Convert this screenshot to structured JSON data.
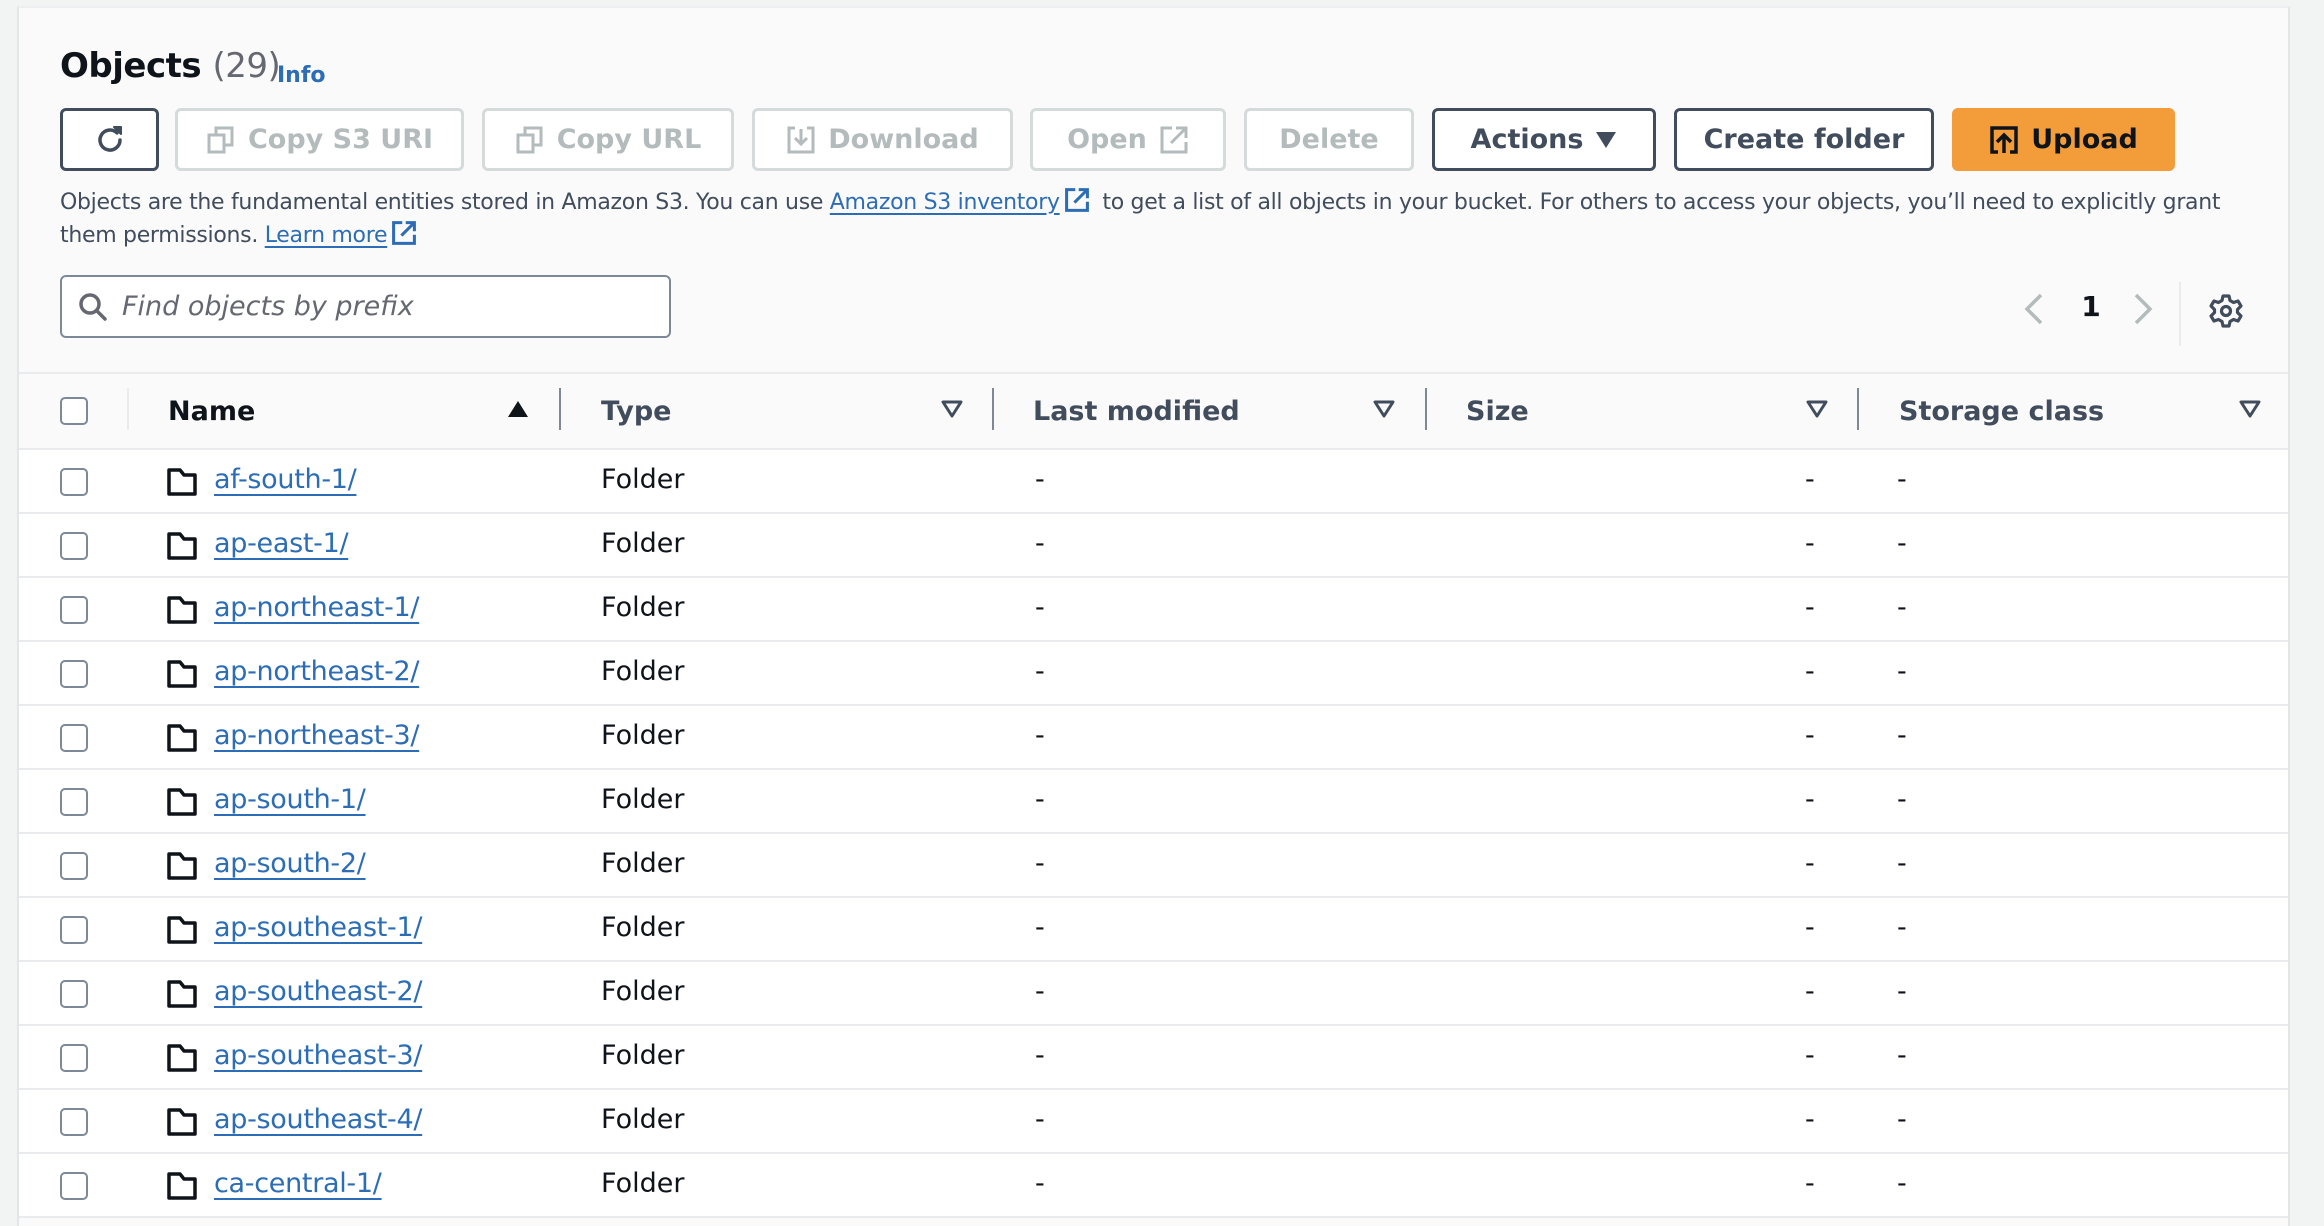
{
  "header": {
    "title": "Objects",
    "count": "(29)",
    "info_label": "Info"
  },
  "toolbar": {
    "refresh_label": "Refresh",
    "copy_s3_uri_label": "Copy S3 URI",
    "copy_url_label": "Copy URL",
    "download_label": "Download",
    "open_label": "Open",
    "delete_label": "Delete",
    "actions_label": "Actions",
    "create_folder_label": "Create folder",
    "upload_label": "Upload"
  },
  "description": {
    "part1": "Objects are the fundamental entities stored in Amazon S3. You can use ",
    "inventory_link": "Amazon S3 inventory",
    "part2": " to get a list of all objects in your bucket. For others to access your objects, you’ll need to explicitly grant them permissions. ",
    "learn_more_link": "Learn more"
  },
  "search": {
    "placeholder": "Find objects by prefix",
    "value": ""
  },
  "pagination": {
    "current_page": "1"
  },
  "table": {
    "columns": [
      {
        "label": "Name",
        "sort": "ascending"
      },
      {
        "label": "Type",
        "sort": "none"
      },
      {
        "label": "Last modified",
        "sort": "none"
      },
      {
        "label": "Size",
        "sort": "none"
      },
      {
        "label": "Storage class",
        "sort": "none"
      }
    ],
    "rows": [
      {
        "name": "af-south-1/",
        "type": "Folder",
        "last_modified": "-",
        "size": "-",
        "storage_class": "-"
      },
      {
        "name": "ap-east-1/",
        "type": "Folder",
        "last_modified": "-",
        "size": "-",
        "storage_class": "-"
      },
      {
        "name": "ap-northeast-1/",
        "type": "Folder",
        "last_modified": "-",
        "size": "-",
        "storage_class": "-"
      },
      {
        "name": "ap-northeast-2/",
        "type": "Folder",
        "last_modified": "-",
        "size": "-",
        "storage_class": "-"
      },
      {
        "name": "ap-northeast-3/",
        "type": "Folder",
        "last_modified": "-",
        "size": "-",
        "storage_class": "-"
      },
      {
        "name": "ap-south-1/",
        "type": "Folder",
        "last_modified": "-",
        "size": "-",
        "storage_class": "-"
      },
      {
        "name": "ap-south-2/",
        "type": "Folder",
        "last_modified": "-",
        "size": "-",
        "storage_class": "-"
      },
      {
        "name": "ap-southeast-1/",
        "type": "Folder",
        "last_modified": "-",
        "size": "-",
        "storage_class": "-"
      },
      {
        "name": "ap-southeast-2/",
        "type": "Folder",
        "last_modified": "-",
        "size": "-",
        "storage_class": "-"
      },
      {
        "name": "ap-southeast-3/",
        "type": "Folder",
        "last_modified": "-",
        "size": "-",
        "storage_class": "-"
      },
      {
        "name": "ap-southeast-4/",
        "type": "Folder",
        "last_modified": "-",
        "size": "-",
        "storage_class": "-"
      },
      {
        "name": "ca-central-1/",
        "type": "Folder",
        "last_modified": "-",
        "size": "-",
        "storage_class": "-"
      }
    ]
  },
  "colors": {
    "primary_button": "#f39c3a",
    "link": "#2c6db5",
    "text_dark": "#0f141a",
    "text_secondary": "#414d5c",
    "disabled": "#b3bbbc"
  }
}
